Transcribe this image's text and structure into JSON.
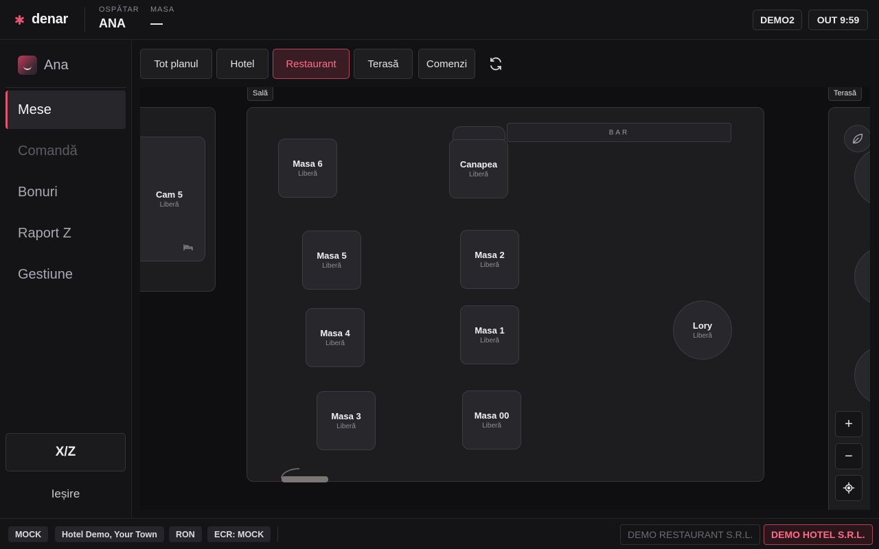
{
  "app": {
    "name": "denar"
  },
  "header": {
    "waiter_label": "OSPĂTAR",
    "waiter_value": "ANA",
    "table_label": "MASA",
    "table_value": "—",
    "device_badge": "DEMO2",
    "shift_badge": "OUT 9:59"
  },
  "sidebar": {
    "user": "Ana",
    "items": [
      {
        "label": "Mese",
        "state": "active"
      },
      {
        "label": "Comandă",
        "state": "disabled"
      },
      {
        "label": "Bonuri",
        "state": "normal"
      },
      {
        "label": "Raport Z",
        "state": "normal"
      },
      {
        "label": "Gestiune",
        "state": "normal"
      }
    ],
    "xz_label": "X/Z",
    "exit_label": "Ieșire"
  },
  "tabs": [
    {
      "label": "Tot planul",
      "active": false
    },
    {
      "label": "Hotel",
      "active": false
    },
    {
      "label": "Restaurant",
      "active": true
    },
    {
      "label": "Terasă",
      "active": false
    },
    {
      "label": "Comenzi",
      "active": false
    }
  ],
  "floor_plan": {
    "zones": {
      "hotel": {
        "rooms": [
          {
            "name": "Cam 5",
            "status": "Liberă"
          }
        ]
      },
      "sala": {
        "tag": "Sală",
        "bar_label": "BAR",
        "tables": [
          {
            "name": "Masa 6",
            "status": "Liberă"
          },
          {
            "name": "Canapea",
            "status": "Liberă"
          },
          {
            "name": "Masa 5",
            "status": "Liberă"
          },
          {
            "name": "Masa 2",
            "status": "Liberă"
          },
          {
            "name": "Masa 4",
            "status": "Liberă"
          },
          {
            "name": "Masa 1",
            "status": "Liberă"
          },
          {
            "name": "Lory",
            "status": "Liberă"
          },
          {
            "name": "Masa 3",
            "status": "Liberă"
          },
          {
            "name": "Masa 00",
            "status": "Liberă"
          }
        ]
      },
      "terasa": {
        "tag": "Terasă"
      }
    }
  },
  "zoom": {
    "in": "+",
    "out": "−"
  },
  "footer": {
    "chips": [
      "MOCK",
      "Hotel Demo, Your Town",
      "RON",
      "ECR: MOCK"
    ],
    "companies": [
      {
        "label": "DEMO RESTAURANT S.R.L.",
        "active": false
      },
      {
        "label": "DEMO HOTEL S.R.L.",
        "active": true
      }
    ]
  },
  "colors": {
    "accent": "#e65572",
    "background": "#121214",
    "surface": "#1d1d20"
  }
}
